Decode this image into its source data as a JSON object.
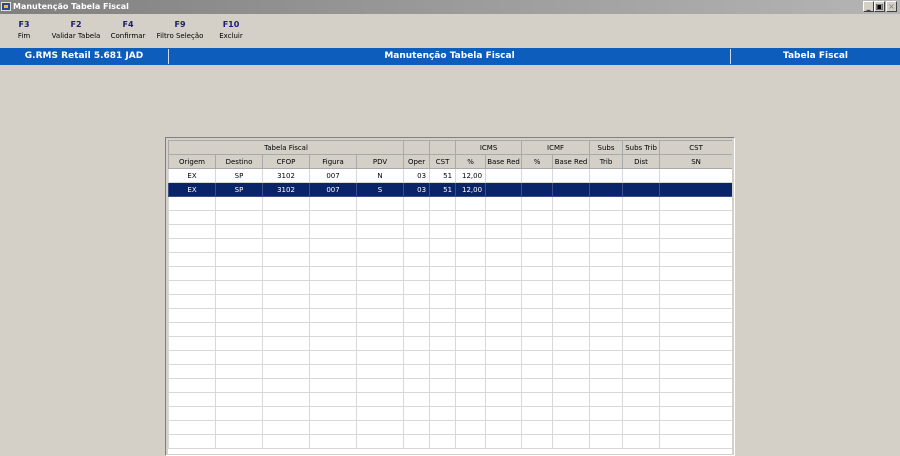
{
  "window": {
    "title": "Manutenção Tabela Fiscal"
  },
  "toolbar": {
    "items": [
      {
        "key": "F3",
        "label": "Fim"
      },
      {
        "key": "F2",
        "label": "Validar Tabela"
      },
      {
        "key": "F4",
        "label": "Confirmar"
      },
      {
        "key": "F9",
        "label": "Filtro Seleção"
      },
      {
        "key": "F10",
        "label": "Excluir"
      }
    ]
  },
  "infobar": {
    "system": "G.RMS Retail 5.681 JAD",
    "screen": "Manutenção Tabela Fiscal",
    "context": "Tabela Fiscal"
  },
  "grid": {
    "group_headers": {
      "tabela_fiscal": "Tabela Fiscal",
      "icms": "ICMS",
      "icmf": "ICMF",
      "subs": "Subs",
      "subs_trib": "Subs Trib",
      "cst": "CST"
    },
    "columns": {
      "origem": "Origem",
      "destino": "Destino",
      "cfop": "CFOP",
      "figura": "Figura",
      "pdv": "PDV",
      "oper": "Oper",
      "cst": "CST",
      "icms_pct": "%",
      "icms_base_red": "Base Red",
      "icmf_pct": "%",
      "icmf_base_red": "Base Red",
      "subs_trib": "Trib",
      "subs_trib_dist": "Dist",
      "cst_sn": "SN"
    },
    "rows": [
      {
        "origem": "EX",
        "destino": "SP",
        "cfop": "3102",
        "figura": "007",
        "pdv": "N",
        "oper": "03",
        "cst": "51",
        "icms_pct": "12,00",
        "icms_base_red": "",
        "icmf_pct": "",
        "icmf_base_red": "",
        "subs_trib": "",
        "subs_trib_dist": "",
        "cst_sn": ""
      },
      {
        "origem": "EX",
        "destino": "SP",
        "cfop": "3102",
        "figura": "007",
        "pdv": "S",
        "oper": "03",
        "cst": "51",
        "icms_pct": "12,00",
        "icms_base_red": "",
        "icmf_pct": "",
        "icmf_base_red": "",
        "subs_trib": "",
        "subs_trib_dist": "",
        "cst_sn": ""
      }
    ],
    "selected_row": 1
  }
}
